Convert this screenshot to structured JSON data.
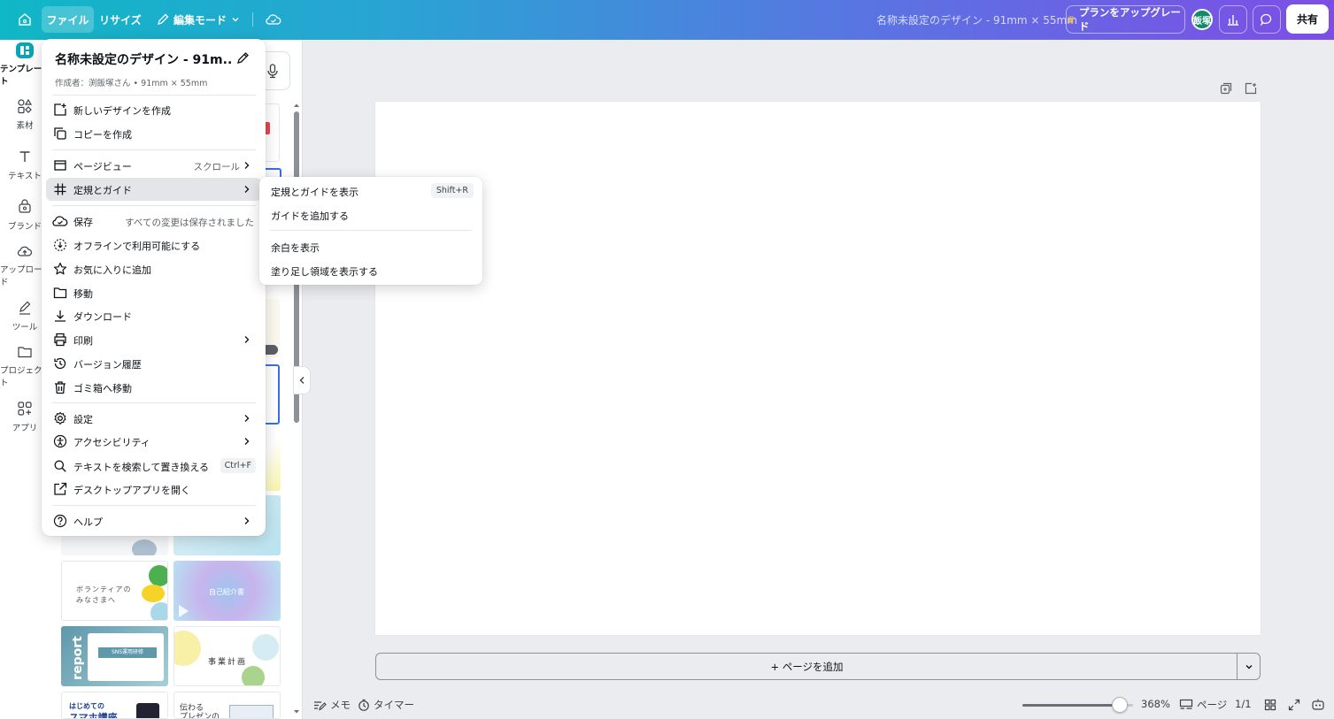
{
  "topbar": {
    "file_label": "ファイル",
    "resize_label": "リサイズ",
    "edit_mode_label": "編集モード",
    "design_title": "名称未設定のデザイン - 91mm × 55mm",
    "upgrade_label": "プランをアップグレード",
    "avatar_text": "飯塚",
    "share_label": "共有",
    "accent_gradient": [
      "#10b7c6",
      "#7d4ee6"
    ]
  },
  "rail": {
    "items": [
      {
        "label": "テンプレート",
        "icon": "template-icon"
      },
      {
        "label": "素材",
        "icon": "elements-icon"
      },
      {
        "label": "テキスト",
        "icon": "text-icon"
      },
      {
        "label": "ブランド",
        "icon": "brand-icon"
      },
      {
        "label": "アップロード",
        "icon": "upload-icon"
      },
      {
        "label": "ツール",
        "icon": "tools-icon"
      },
      {
        "label": "プロジェクト",
        "icon": "folder-icon"
      },
      {
        "label": "アプリ",
        "icon": "apps-icon"
      }
    ]
  },
  "file_menu": {
    "title": "名称未設定のデザイン - 91m...",
    "subtitle": "作成者：渕飯塚さん • 91mm × 55mm",
    "items": [
      {
        "label": "新しいデザインを作成",
        "icon": "new-design-icon"
      },
      {
        "label": "コピーを作成",
        "icon": "copy-icon"
      },
      {
        "label": "ページビュー",
        "right": "スクロール",
        "icon": "page-view-icon"
      },
      {
        "label": "定規とガイド",
        "icon": "grid-icon"
      },
      {
        "label": "保存",
        "right": "すべての変更は保存されました",
        "icon": "cloud-save-icon"
      },
      {
        "label": "オフラインで利用可能にする",
        "icon": "offline-icon"
      },
      {
        "label": "お気に入りに追加",
        "icon": "star-icon"
      },
      {
        "label": "移動",
        "icon": "folder-move-icon"
      },
      {
        "label": "ダウンロード",
        "icon": "download-icon"
      },
      {
        "label": "印刷",
        "icon": "print-icon"
      },
      {
        "label": "バージョン履歴",
        "icon": "history-icon"
      },
      {
        "label": "ゴミ箱へ移動",
        "icon": "trash-icon"
      },
      {
        "label": "設定",
        "icon": "settings-icon"
      },
      {
        "label": "アクセシビリティ",
        "icon": "accessibility-icon"
      },
      {
        "label": "テキストを検索して置き換える",
        "shortcut": "Ctrl+F",
        "icon": "search-icon"
      },
      {
        "label": "デスクトップアプリを開く",
        "icon": "external-link-icon"
      },
      {
        "label": "ヘルプ",
        "icon": "help-icon"
      }
    ]
  },
  "submenu": {
    "items": [
      {
        "label": "定規とガイドを表示",
        "shortcut": "Shift+R"
      },
      {
        "label": "ガイドを追加する"
      },
      {
        "label": "余白を表示"
      },
      {
        "label": "塗り足し領域を表示する"
      }
    ]
  },
  "canvas": {
    "add_page_label": "+ ページを追加"
  },
  "bottombar": {
    "notes_label": "メモ",
    "timer_label": "タイマー",
    "zoom_level": "368%",
    "zoom_fraction": 0.88,
    "pages_label": "ページ",
    "page_counter": "1/1"
  },
  "thumbnails": {
    "volunteer_top": "ボランティアの",
    "volunteer_bottom": "みなさまへ",
    "smartphone_top": "はじめての",
    "smartphone_bottom": "スマホ講座",
    "presen_top": "伝わる",
    "presen_bottom": "プレゼンの",
    "business_plan": "事業計画",
    "intro": "自己紹介書",
    "report": "report",
    "sns_title": "SNS運用研修"
  }
}
